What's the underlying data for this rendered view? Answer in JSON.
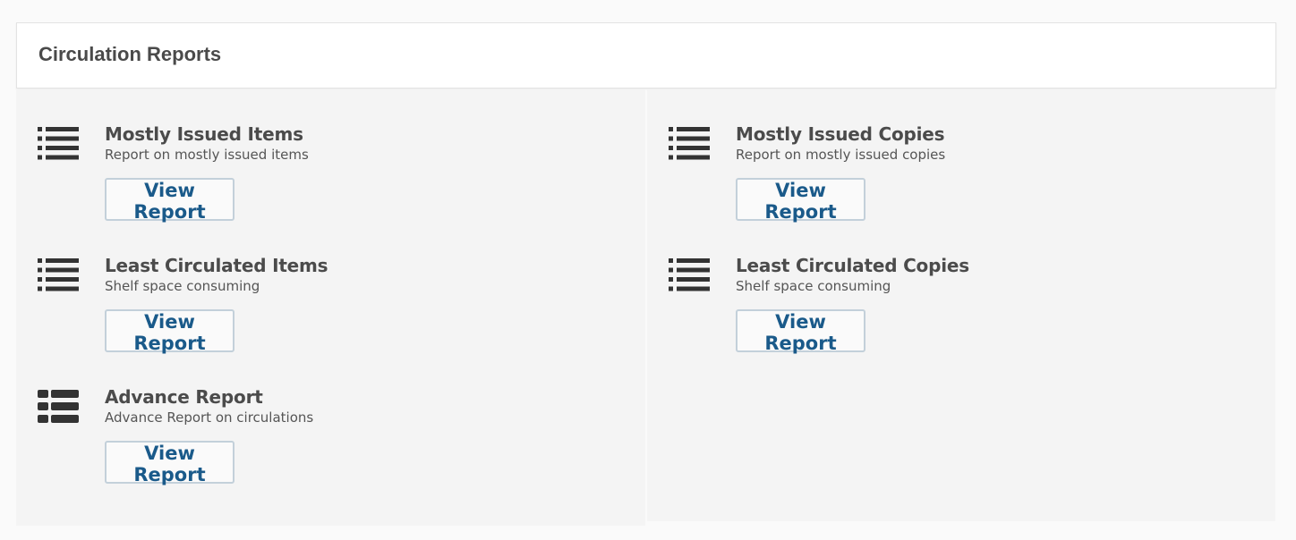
{
  "panel": {
    "title": "Circulation Reports"
  },
  "reports": [
    {
      "title": "Mostly Issued Items",
      "description": "Report on mostly issued items",
      "button": "View Report",
      "icon": "list-icon"
    },
    {
      "title": "Least Circulated Items",
      "description": "Shelf space consuming",
      "button": "View Report",
      "icon": "list-icon"
    },
    {
      "title": "Advance Report",
      "description": "Advance Report on circulations",
      "button": "View Report",
      "icon": "th-list-icon"
    },
    {
      "title": "Mostly Issued Copies",
      "description": "Report on mostly issued copies",
      "button": "View Report",
      "icon": "list-icon"
    },
    {
      "title": "Least Circulated Copies",
      "description": "Shelf space consuming",
      "button": "View Report",
      "icon": "list-icon"
    }
  ],
  "colors": {
    "icon": "#333333",
    "button_text": "#1a5a8a",
    "button_border": "#c3d0da",
    "panel_bg": "#f4f4f4"
  }
}
